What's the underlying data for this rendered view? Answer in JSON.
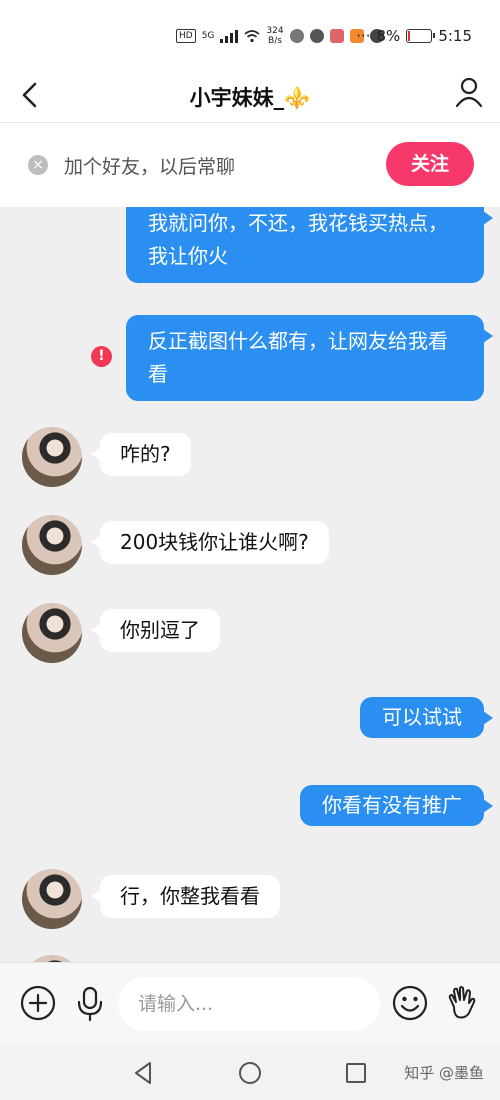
{
  "status_bar": {
    "hd_badge": "HD",
    "network": "5G",
    "speed_value": "324",
    "speed_unit": "B/s",
    "battery": "8%",
    "time": "5:15"
  },
  "header": {
    "title": "小宇妹妹_⚜️"
  },
  "banner": {
    "text": "加个好友，以后常聊",
    "follow_label": "关注"
  },
  "messages": [
    {
      "side": "out",
      "text": "我就问你，不还，我花钱买热点，我让你火"
    },
    {
      "side": "out",
      "text": "反正截图什么都有，让网友给我看看",
      "error": true
    },
    {
      "side": "in",
      "text": "咋的?"
    },
    {
      "side": "in",
      "text": "200块钱你让谁火啊?"
    },
    {
      "side": "in",
      "text": "你别逗了"
    },
    {
      "side": "out",
      "text": "可以试试"
    },
    {
      "side": "out",
      "text": "你看有没有推广"
    },
    {
      "side": "in",
      "text": "行，你整我看看"
    }
  ],
  "input": {
    "placeholder": "请输入..."
  },
  "nav": {
    "watermark": "知乎 @墨鱼"
  }
}
